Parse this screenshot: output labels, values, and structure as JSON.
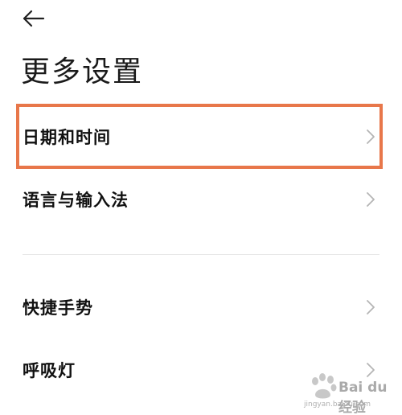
{
  "header": {
    "back_icon": "arrow-left-icon",
    "title": "更多设置"
  },
  "settings": {
    "items": [
      {
        "label": "日期和时间",
        "icon": "chevron-right-icon",
        "highlighted": true
      },
      {
        "label": "语言与输入法",
        "icon": "chevron-right-icon"
      },
      {
        "label": "快捷手势",
        "icon": "chevron-right-icon"
      },
      {
        "label": "呼吸灯",
        "icon": "chevron-right-icon"
      }
    ]
  },
  "colors": {
    "highlight": "#e8774a",
    "chevron": "#b5b5b5",
    "divider": "#e6e6e6"
  },
  "watermark": {
    "logo": "baidu-paw-logo",
    "text": "Bai du 经验",
    "url": "jingyan.baidu.com"
  }
}
